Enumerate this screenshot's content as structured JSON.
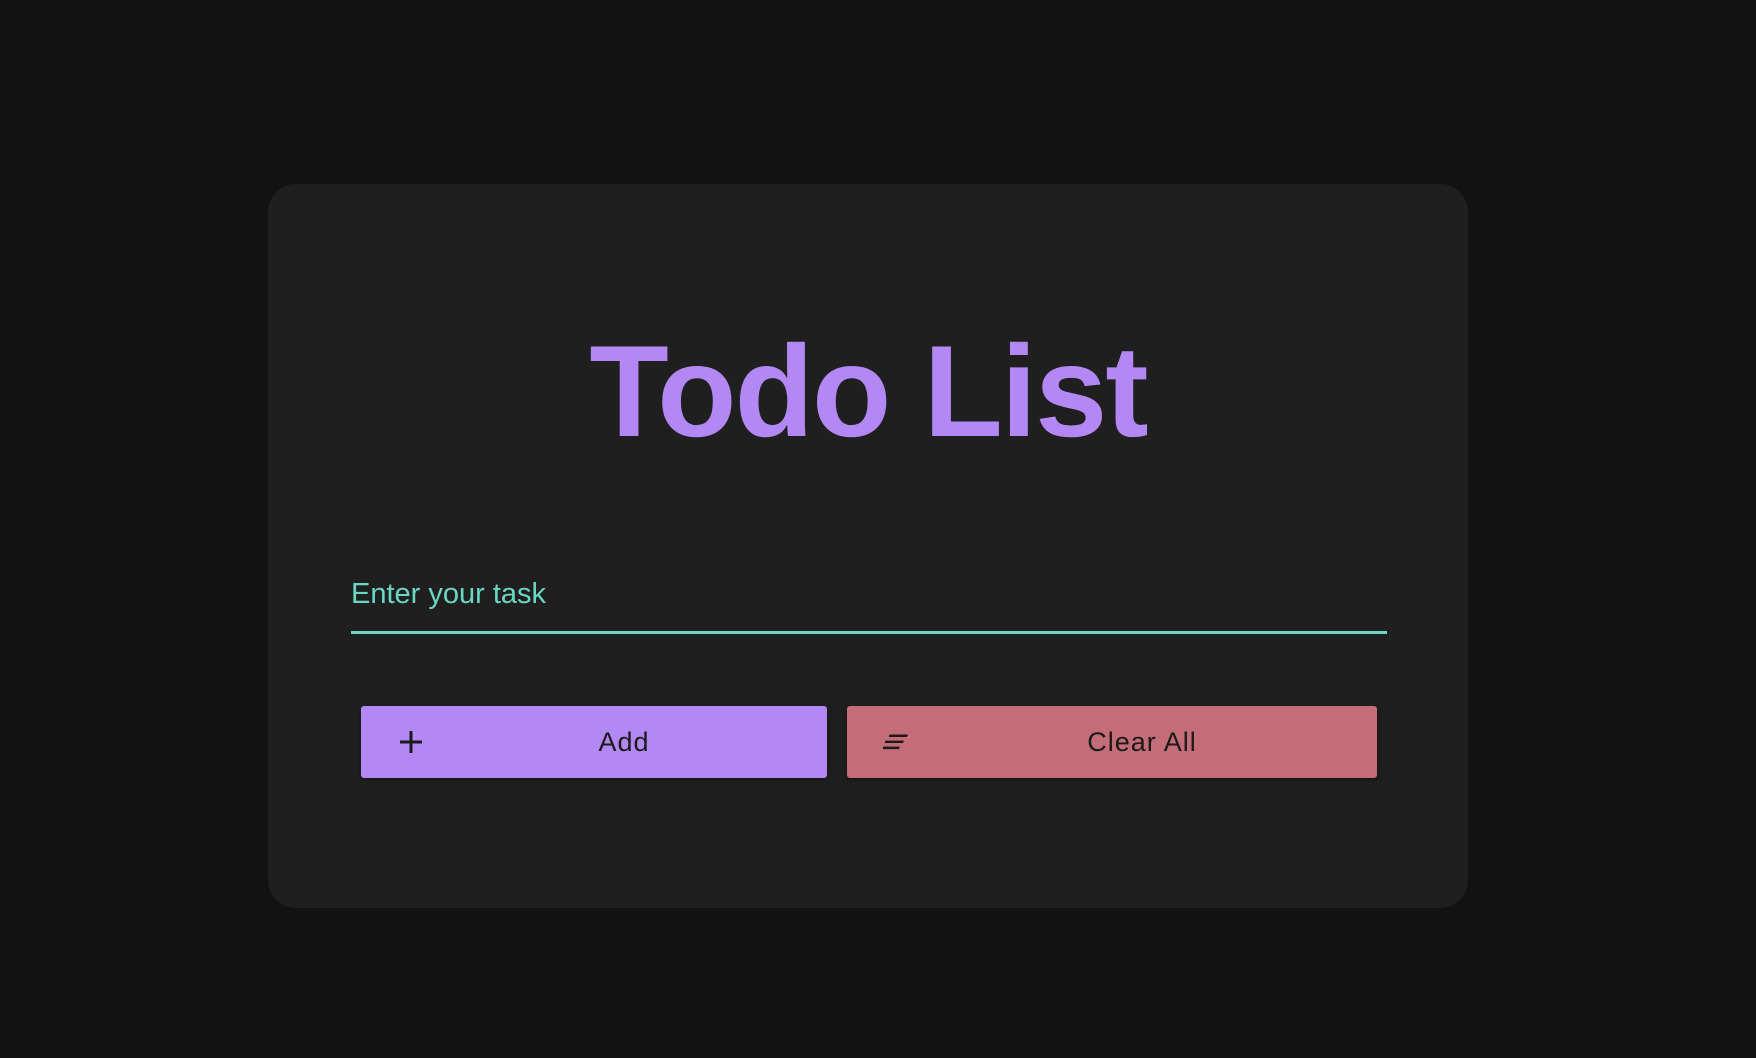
{
  "app": {
    "title": "Todo List"
  },
  "task_input": {
    "value": "",
    "placeholder": "Enter your task"
  },
  "actions": {
    "add": {
      "label": "Add",
      "icon": "plus-icon"
    },
    "clear": {
      "label": "Clear All",
      "icon": "clear-all-icon"
    }
  },
  "colors": {
    "page_background": "#121212",
    "card_background": "#1f1f1f",
    "accent_purple": "#b388f4",
    "accent_teal": "#6bd6c4",
    "danger_red": "#c46c78"
  }
}
